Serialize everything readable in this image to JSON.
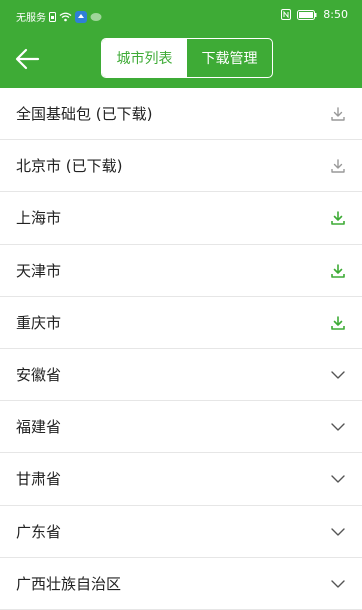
{
  "status_bar": {
    "carrier": "无服务",
    "time": "8:50"
  },
  "header": {
    "tabs": [
      {
        "label": "城市列表",
        "active": true
      },
      {
        "label": "下载管理",
        "active": false
      }
    ]
  },
  "colors": {
    "primary": "#3eab36",
    "downloaded_icon": "#999999",
    "download_icon": "#3eab36",
    "chevron": "#555555"
  },
  "list": [
    {
      "label": "全国基础包 (已下载)",
      "icon": "downloaded-icon"
    },
    {
      "label": "北京市 (已下载)",
      "icon": "downloaded-icon"
    },
    {
      "label": "上海市",
      "icon": "download-icon"
    },
    {
      "label": "天津市",
      "icon": "download-icon"
    },
    {
      "label": "重庆市",
      "icon": "download-icon"
    },
    {
      "label": "安徽省",
      "icon": "chevron-down-icon"
    },
    {
      "label": "福建省",
      "icon": "chevron-down-icon"
    },
    {
      "label": "甘肃省",
      "icon": "chevron-down-icon"
    },
    {
      "label": "广东省",
      "icon": "chevron-down-icon"
    },
    {
      "label": "广西壮族自治区",
      "icon": "chevron-down-icon"
    }
  ]
}
